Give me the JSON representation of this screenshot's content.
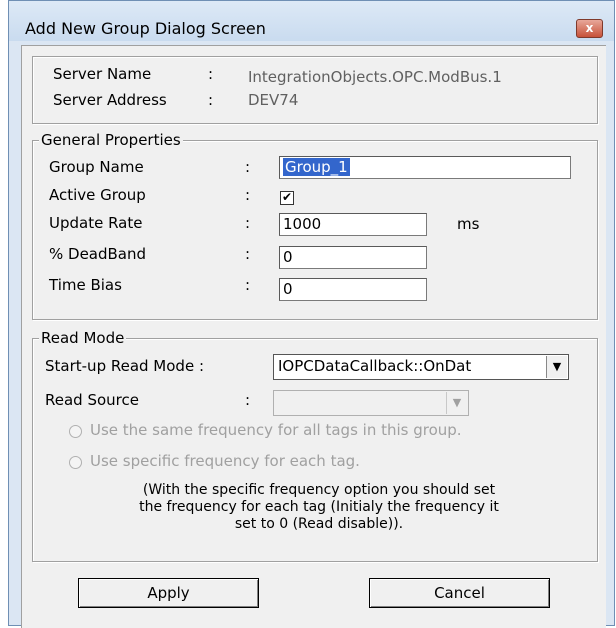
{
  "window": {
    "title": "Add New Group Dialog Screen",
    "close_label": "x"
  },
  "server": {
    "name_label": "Server Name",
    "name_value": "IntegrationObjects.OPC.ModBus.1",
    "address_label": "Server Address",
    "address_value": "DEV74"
  },
  "general": {
    "legend": "General  Properties",
    "group_name_label": "Group Name",
    "group_name_value": "Group_1",
    "active_label": "Active Group",
    "active_checked": "✔",
    "update_rate_label": "Update Rate",
    "update_rate_value": "1000",
    "update_rate_unit": "ms",
    "deadband_label": "% DeadBand",
    "deadband_value": "0",
    "time_bias_label": "Time Bias",
    "time_bias_value": "0"
  },
  "read_mode": {
    "legend": "Read Mode",
    "startup_label": "Start-up Read Mode :",
    "startup_value": "IOPCDataCallback::OnDat",
    "source_label": "Read Source",
    "source_value": "",
    "radio_same": "Use the same frequency for all tags in this group.",
    "radio_specific": "Use specific frequency for each tag.",
    "note_line1": "(With the specific frequency option you should set",
    "note_line2": "the frequency for each tag (Initialy the frequency it",
    "note_line3": "set to 0 (Read disable))."
  },
  "buttons": {
    "apply": "Apply",
    "cancel": "Cancel"
  },
  "colon": ":"
}
